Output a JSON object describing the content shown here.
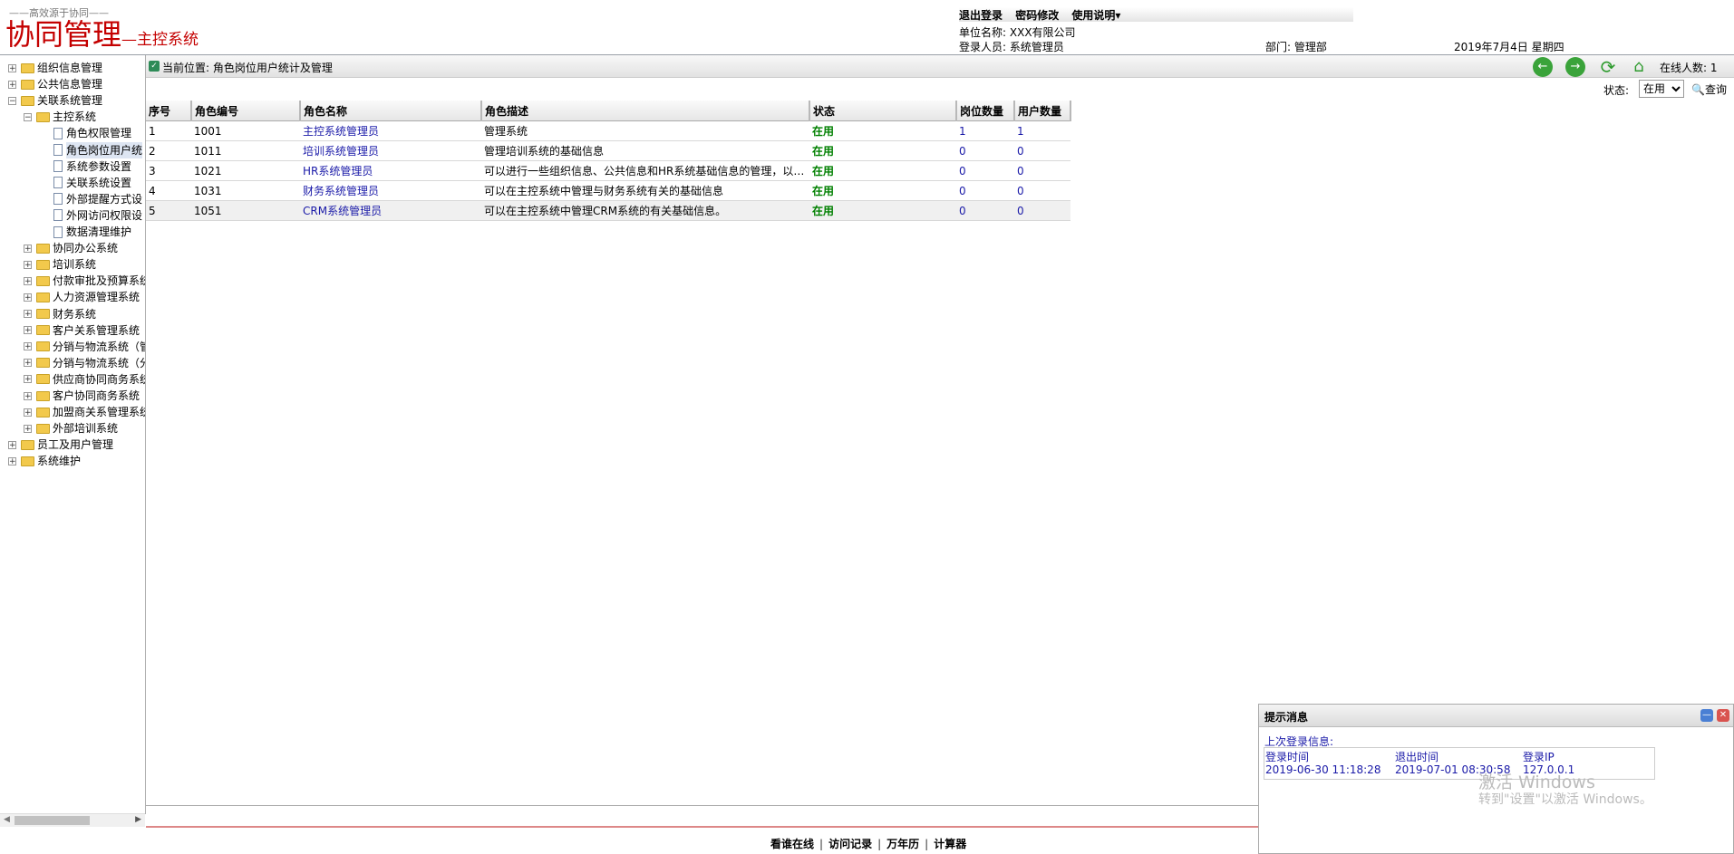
{
  "header": {
    "slogan": "——高效源于协同——",
    "logo_main": "协同管理",
    "logo_sub": "—主控系统",
    "links": [
      "退出登录",
      "密码修改",
      "使用说明▾"
    ],
    "company_label": "单位名称:",
    "company": "XXX有限公司",
    "user_label": "登录人员:",
    "user": "系统管理员",
    "dept_label": "部门:",
    "dept": "管理部",
    "date": "2019年7月4日 星期四"
  },
  "tree": {
    "items": [
      {
        "label": "组织信息管理",
        "level": 0,
        "type": "folder",
        "expander": "+"
      },
      {
        "label": "公共信息管理",
        "level": 0,
        "type": "folder",
        "expander": "+"
      },
      {
        "label": "关联系统管理",
        "level": 0,
        "type": "folder",
        "expander": "−"
      },
      {
        "label": "主控系统",
        "level": 1,
        "type": "folder",
        "expander": "−"
      },
      {
        "label": "角色权限管理",
        "level": 2,
        "type": "doc"
      },
      {
        "label": "角色岗位用户统",
        "level": 2,
        "type": "doc",
        "selected": true
      },
      {
        "label": "系统参数设置",
        "level": 2,
        "type": "doc"
      },
      {
        "label": "关联系统设置",
        "level": 2,
        "type": "doc"
      },
      {
        "label": "外部提醒方式设",
        "level": 2,
        "type": "doc"
      },
      {
        "label": "外网访问权限设",
        "level": 2,
        "type": "doc"
      },
      {
        "label": "数据清理维护",
        "level": 2,
        "type": "doc"
      },
      {
        "label": "协同办公系统",
        "level": 1,
        "type": "folder",
        "expander": "+"
      },
      {
        "label": "培训系统",
        "level": 1,
        "type": "folder",
        "expander": "+"
      },
      {
        "label": "付款审批及预算系统",
        "level": 1,
        "type": "folder",
        "expander": "+"
      },
      {
        "label": "人力资源管理系统",
        "level": 1,
        "type": "folder",
        "expander": "+"
      },
      {
        "label": "财务系统",
        "level": 1,
        "type": "folder",
        "expander": "+"
      },
      {
        "label": "客户关系管理系统",
        "level": 1,
        "type": "folder",
        "expander": "+"
      },
      {
        "label": "分销与物流系统（管",
        "level": 1,
        "type": "folder",
        "expander": "+"
      },
      {
        "label": "分销与物流系统（分",
        "level": 1,
        "type": "folder",
        "expander": "+"
      },
      {
        "label": "供应商协同商务系统",
        "level": 1,
        "type": "folder",
        "expander": "+"
      },
      {
        "label": "客户协同商务系统",
        "level": 1,
        "type": "folder",
        "expander": "+"
      },
      {
        "label": "加盟商关系管理系统",
        "level": 1,
        "type": "folder",
        "expander": "+"
      },
      {
        "label": "外部培训系统",
        "level": 1,
        "type": "folder",
        "expander": "+"
      },
      {
        "label": "员工及用户管理",
        "level": 0,
        "type": "folder",
        "expander": "+"
      },
      {
        "label": "系统维护",
        "level": 0,
        "type": "folder",
        "expander": "+"
      }
    ]
  },
  "breadcrumb": {
    "text": "当前位置: 角色岗位用户统计及管理"
  },
  "toolbar": {
    "online_label": "在线人数:",
    "online_count": "1",
    "icons": [
      "back-icon",
      "forward-icon",
      "refresh-icon",
      "home-icon"
    ]
  },
  "filter": {
    "status_label": "状态:",
    "status_value": "在用",
    "query_label": "查询"
  },
  "table": {
    "columns": [
      "序号",
      "角色编号",
      "角色名称",
      "角色描述",
      "状态",
      "岗位数量",
      "用户数量"
    ],
    "rows": [
      [
        "1",
        "1001",
        "主控系统管理员",
        "管理系统",
        "在用",
        "1",
        "1"
      ],
      [
        "2",
        "1011",
        "培训系统管理员",
        "管理培训系统的基础信息",
        "在用",
        "0",
        "0"
      ],
      [
        "3",
        "1021",
        "HR系统管理员",
        "可以进行一些组织信息、公共信息和HR系统基础信息的管理，以…",
        "在用",
        "0",
        "0"
      ],
      [
        "4",
        "1031",
        "财务系统管理员",
        "可以在主控系统中管理与财务系统有关的基础信息",
        "在用",
        "0",
        "0"
      ],
      [
        "5",
        "1051",
        "CRM系统管理员",
        "可以在主控系统中管理CRM系统的有关基础信息。",
        "在用",
        "0",
        "0"
      ]
    ]
  },
  "footer": {
    "links": [
      "看谁在线",
      "访问记录",
      "万年历",
      "计算器"
    ]
  },
  "popup": {
    "title": "提示消息",
    "last_login_label": "上次登录信息:",
    "col_login_time": "登录时间",
    "col_logout_time": "退出时间",
    "col_ip": "登录IP",
    "login_time": "2019-06-30 11:18:28",
    "logout_time": "2019-07-01 08:30:58",
    "ip": "127.0.0.1",
    "watermark_line1": "激活 Windows",
    "watermark_line2": "转到\"设置\"以激活 Windows。"
  }
}
